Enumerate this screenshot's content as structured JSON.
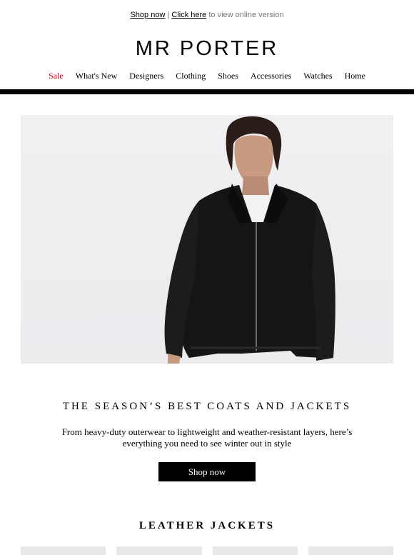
{
  "preheader": {
    "shop_now": "Shop now",
    "separator": "|",
    "click_here": "Click here",
    "rest": "to view online version"
  },
  "brand": {
    "logo": "MR PORTER"
  },
  "nav": {
    "items": [
      {
        "label": "Sale"
      },
      {
        "label": "What's New"
      },
      {
        "label": "Designers"
      },
      {
        "label": "Clothing"
      },
      {
        "label": "Shoes"
      },
      {
        "label": "Accessories"
      },
      {
        "label": "Watches"
      },
      {
        "label": "Home"
      }
    ]
  },
  "hero": {
    "heading": "THE SEASON’S BEST COATS AND JACKETS",
    "body": "From heavy-duty outerwear to lightweight and weather-resistant layers, here’s everything you need to see winter out in style",
    "cta": "Shop now"
  },
  "section": {
    "heading": "LEATHER JACKETS"
  },
  "colors": {
    "sale": "#d0021b",
    "cta_bg": "#000000",
    "rule": "#000000"
  }
}
